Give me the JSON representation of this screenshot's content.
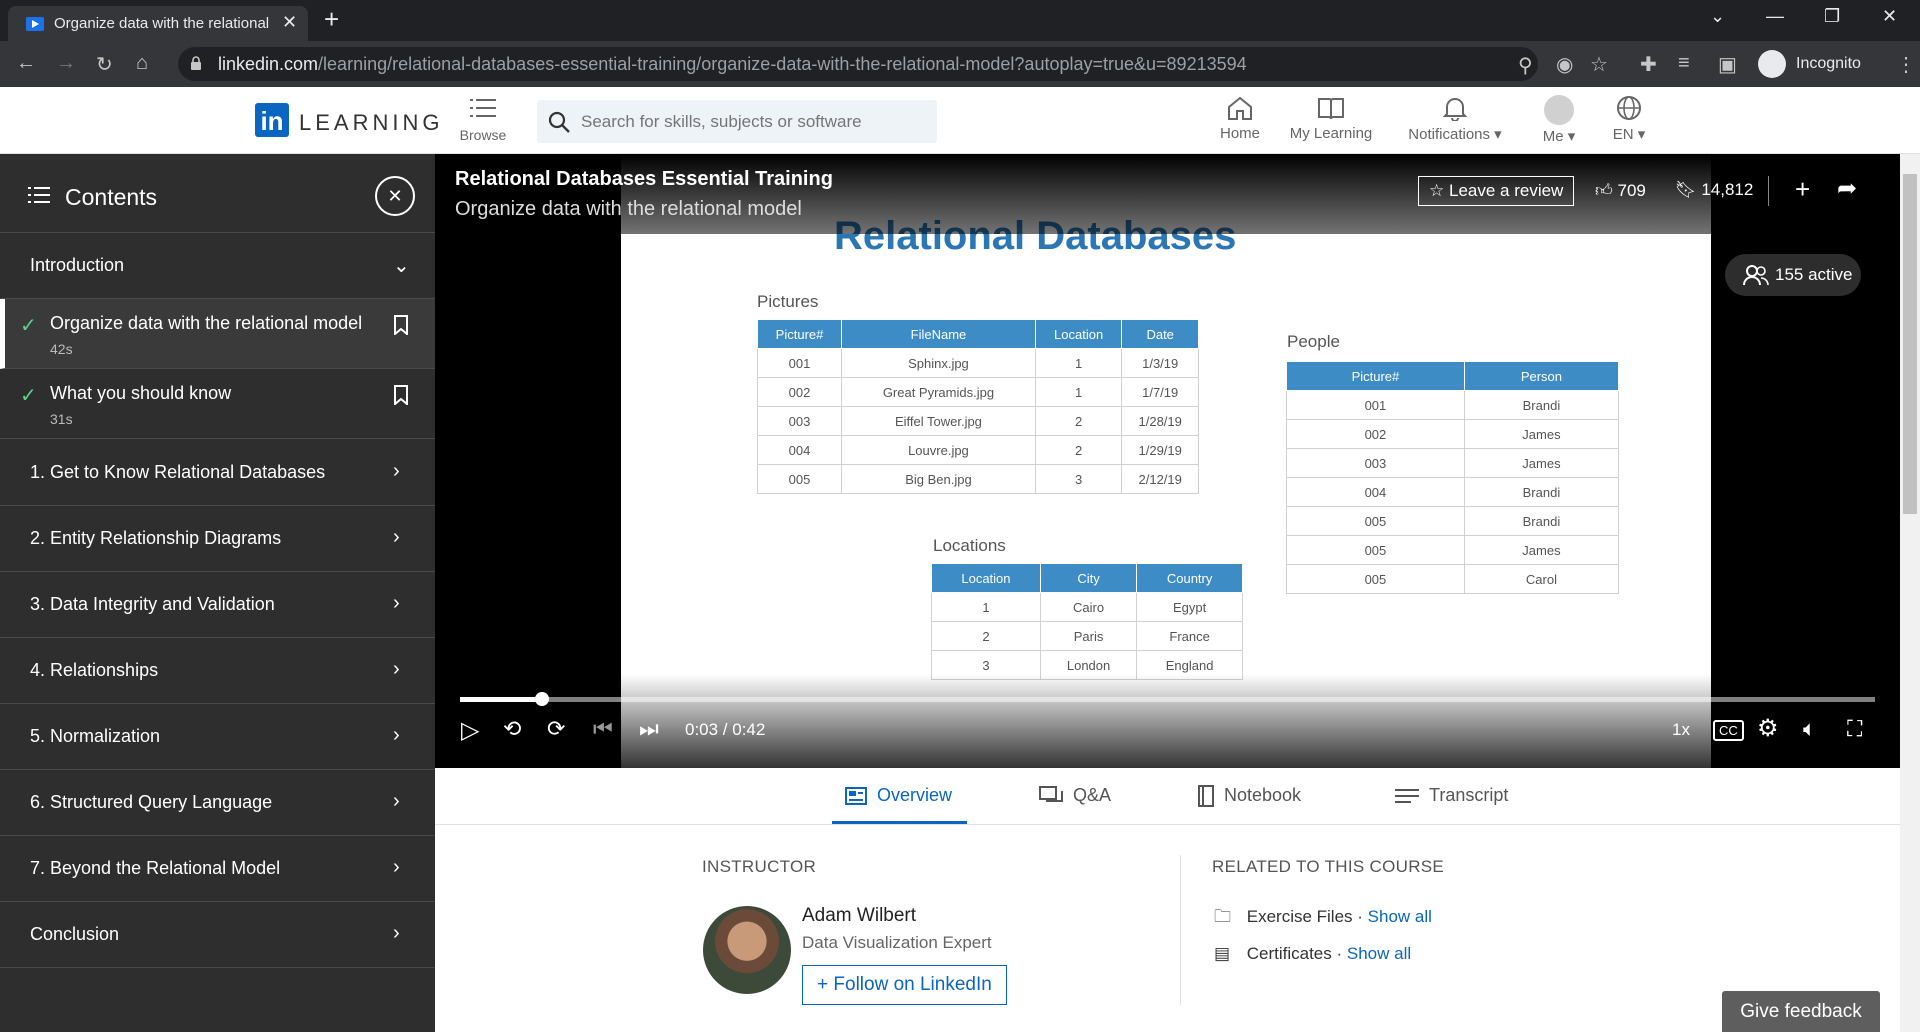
{
  "browser": {
    "tab_title": "Organize data with the relational",
    "url_domain": "linkedin.com",
    "url_path": "/learning/relational-databases-essential-training/organize-data-with-the-relational-model?autoplay=true&u=89213594",
    "profile_label": "Incognito"
  },
  "header": {
    "logo_text": "LEARNING",
    "browse_label": "Browse",
    "search_placeholder": "Search for skills, subjects or software",
    "nav": [
      {
        "label": "Home",
        "icon": "home-icon"
      },
      {
        "label": "My Learning",
        "icon": "book-icon"
      },
      {
        "label": "Notifications",
        "icon": "bell-icon"
      },
      {
        "label": "Me",
        "icon": "avatar-icon"
      },
      {
        "label": "EN",
        "icon": "globe-icon"
      }
    ]
  },
  "sidebar": {
    "title": "Contents",
    "intro_label": "Introduction",
    "videos": [
      {
        "name": "Organize data with the relational model",
        "duration": "42s",
        "active": true
      },
      {
        "name": "What you should know",
        "duration": "31s",
        "active": false
      }
    ],
    "chapters": [
      "1. Get to Know Relational Databases",
      "2. Entity Relationship Diagrams",
      "3. Data Integrity and Validation",
      "4. Relationships",
      "5. Normalization",
      "6. Structured Query Language",
      "7. Beyond the Relational Model",
      "Conclusion"
    ]
  },
  "player": {
    "course_title": "Relational Databases Essential Training",
    "video_title": "Organize data with the relational model",
    "review_label": "Leave a review",
    "likes": "709",
    "saves": "14,812",
    "active_viewers": "155 active",
    "time": "0:03 / 0:42",
    "progress": 0.058,
    "speed": "1x",
    "slide": {
      "heading": "Relational Databases",
      "pictures": {
        "title": "Pictures",
        "columns": [
          "Picture#",
          "FileName",
          "Location",
          "Date"
        ],
        "rows": [
          [
            "001",
            "Sphinx.jpg",
            "1",
            "1/3/19"
          ],
          [
            "002",
            "Great Pyramids.jpg",
            "1",
            "1/7/19"
          ],
          [
            "003",
            "Eiffel Tower.jpg",
            "2",
            "1/28/19"
          ],
          [
            "004",
            "Louvre.jpg",
            "2",
            "1/29/19"
          ],
          [
            "005",
            "Big Ben.jpg",
            "3",
            "2/12/19"
          ]
        ]
      },
      "people": {
        "title": "People",
        "columns": [
          "Picture#",
          "Person"
        ],
        "rows": [
          [
            "001",
            "Brandi"
          ],
          [
            "002",
            "James"
          ],
          [
            "003",
            "James"
          ],
          [
            "004",
            "Brandi"
          ],
          [
            "005",
            "Brandi"
          ],
          [
            "005",
            "James"
          ],
          [
            "005",
            "Carol"
          ]
        ]
      },
      "locations": {
        "title": "Locations",
        "columns": [
          "Location",
          "City",
          "Country"
        ],
        "rows": [
          [
            "1",
            "Cairo",
            "Egypt"
          ],
          [
            "2",
            "Paris",
            "France"
          ],
          [
            "3",
            "London",
            "England"
          ]
        ]
      }
    }
  },
  "tabs": [
    {
      "label": "Overview",
      "active": true
    },
    {
      "label": "Q&A",
      "active": false
    },
    {
      "label": "Notebook",
      "active": false
    },
    {
      "label": "Transcript",
      "active": false
    }
  ],
  "instructor": {
    "heading": "INSTRUCTOR",
    "name": "Adam Wilbert",
    "title": "Data Visualization Expert",
    "follow_label": "Follow on LinkedIn"
  },
  "related": {
    "heading": "RELATED TO THIS COURSE",
    "items": [
      {
        "label": "Exercise Files",
        "link": "Show all"
      },
      {
        "label": "Certificates",
        "link": "Show all"
      }
    ]
  },
  "feedback_label": "Give feedback",
  "colors": {
    "accent": "#0a66c2",
    "check": "#5bd28a",
    "slide_header": "#3d8cc6",
    "sidebar_bg": "#2e2e2e"
  }
}
